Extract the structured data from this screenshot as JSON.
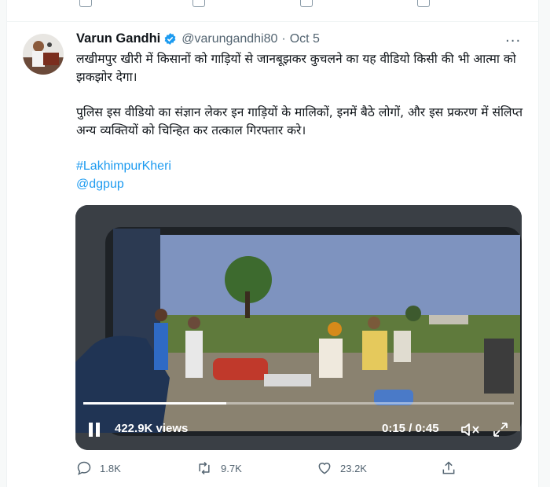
{
  "tweet": {
    "author_name": "Varun Gandhi",
    "handle": "@varungandhi80",
    "separator": "·",
    "date": "Oct 5",
    "more_label": "···",
    "paragraph1": "लखीमपुर खीरी में किसानों को गाड़ियों से जानबूझकर कुचलने का यह वीडियो किसी की भी आत्मा को झकझोर देगा।",
    "paragraph2": "पुलिस इस वीडियो का संज्ञान लेकर इन गाड़ियों के मालिकों, इनमें बैठे लोगों, और इस प्रकरण में संलिप्त अन्य व्यक्तियों को चिन्हित कर तत्काल गिरफ्तार करे।",
    "hashtag": "#LakhimpurKheri",
    "mention": "@dgpup"
  },
  "video": {
    "views": "422.9K views",
    "time": "0:15 / 0:45",
    "progress": 0.333
  },
  "actions": {
    "replies": "1.8K",
    "retweets": "9.7K",
    "likes": "23.2K"
  },
  "colors": {
    "accent": "#1d9bf0",
    "secondary_text": "#536471",
    "video_sky": "#6f87b8",
    "video_field": "#5f7a3c"
  },
  "icons": [
    "verified-icon",
    "more-icon",
    "pause-icon",
    "volume-muted-icon",
    "fullscreen-icon",
    "reply-icon",
    "retweet-icon",
    "like-icon",
    "share-icon"
  ]
}
